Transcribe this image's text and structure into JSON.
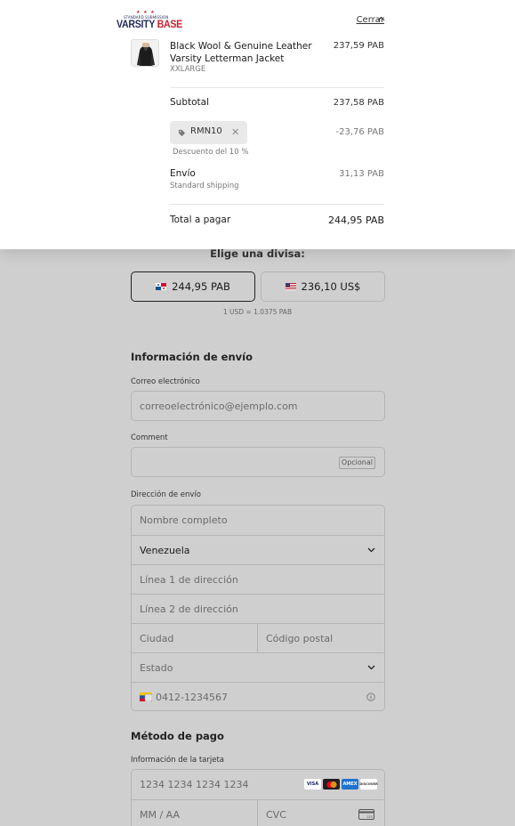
{
  "header": {
    "logo": {
      "top_text": "STANDARD SUBMISSION",
      "word_a": "VARSITY",
      "word_b": "BASE"
    },
    "close_label": "Cerrar"
  },
  "order": {
    "item": {
      "title": "Black Wool & Genuine Leather Varsity Letterman Jacket",
      "variant": "XXLARGE",
      "price": "237,59 PAB"
    },
    "subtotal": {
      "label": "Subtotal",
      "value": "237,58 PAB"
    },
    "discount": {
      "code": "RMN10",
      "value": "-23,76 PAB",
      "note": "Descuento del 10 %"
    },
    "shipping": {
      "label": "Envío",
      "method": "Standard shipping",
      "value": "31,13 PAB"
    },
    "total": {
      "label": "Total a pagar",
      "value": "244,95 PAB"
    }
  },
  "currency": {
    "title": "Elige una divisa:",
    "options": [
      {
        "label": "244,95 PAB",
        "selected": true
      },
      {
        "label": "236,10 US$",
        "selected": false
      }
    ],
    "rate": "1 USD = 1.0375 PAB"
  },
  "shipping_info": {
    "title": "Información de envío",
    "email": {
      "label": "Correo electrónico",
      "placeholder": "correoelectrónico@ejemplo.com"
    },
    "comment": {
      "label": "Comment",
      "badge": "Opcional"
    },
    "address": {
      "label": "Dirección de envío",
      "full_name": "Nombre completo",
      "country": "Venezuela",
      "line1": "Línea 1 de dirección",
      "line2": "Línea 2 de dirección",
      "city": "Ciudad",
      "postal": "Código postal",
      "state": "Estado",
      "phone": "0412-1234567"
    }
  },
  "payment": {
    "title": "Método de pago",
    "card_label": "Información de la tarjeta",
    "number": "1234 1234 1234 1234",
    "expiry": "MM / AA",
    "cvc": "CVC",
    "brands": [
      "VISA",
      "MC",
      "AMEX",
      "DISCOVER"
    ]
  },
  "colors": {
    "brand_navy": "#1f2a5c",
    "brand_red": "#c8202f",
    "overlay": "#cfcfcf"
  }
}
